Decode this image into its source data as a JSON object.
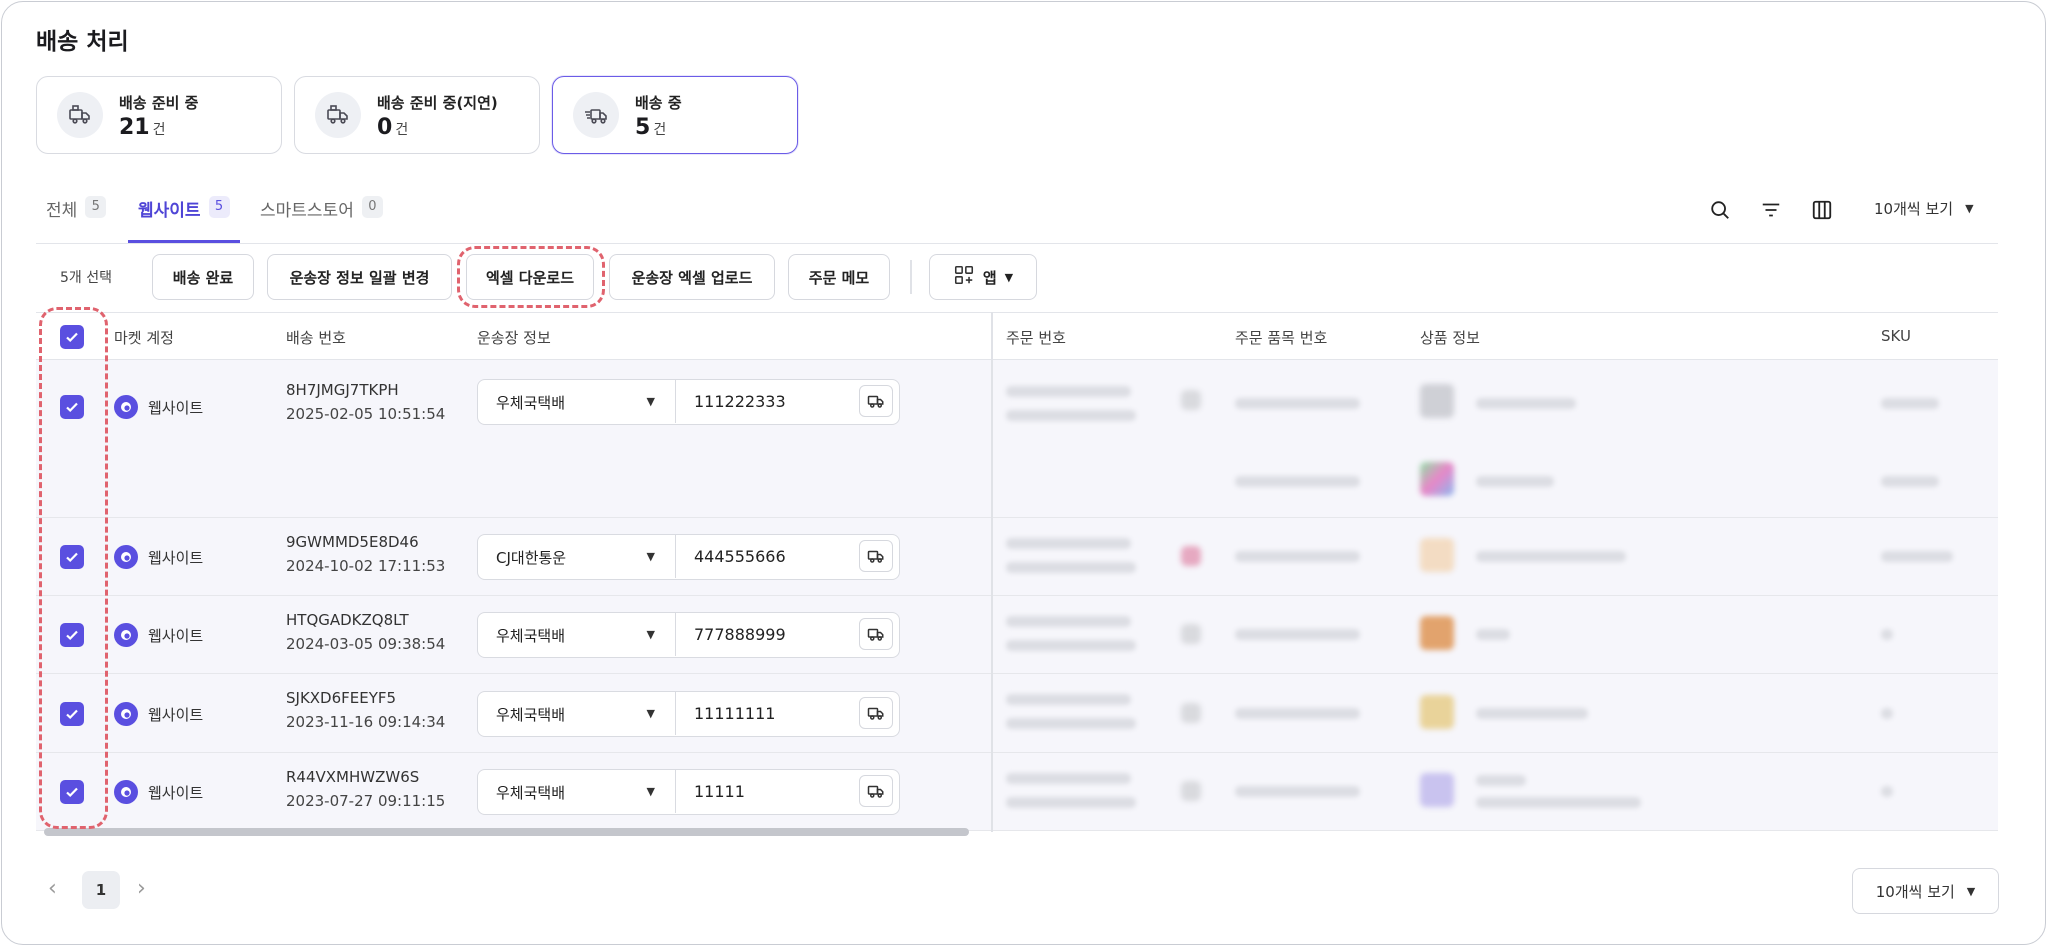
{
  "page": {
    "title": "배송 처리"
  },
  "cards": [
    {
      "label": "배송 준비 중",
      "count": "21",
      "unit": "건",
      "icon": "box-truck-icon",
      "active": false
    },
    {
      "label": "배송 준비 중(지연)",
      "count": "0",
      "unit": "건",
      "icon": "box-truck-icon",
      "active": false
    },
    {
      "label": "배송 중",
      "count": "5",
      "unit": "건",
      "icon": "moving-truck-icon",
      "active": true
    }
  ],
  "tabs": [
    {
      "label": "전체",
      "count": "5",
      "active": false
    },
    {
      "label": "웹사이트",
      "count": "5",
      "active": true
    },
    {
      "label": "스마트스토어",
      "count": "0",
      "active": false
    }
  ],
  "toolbar": {
    "icons": [
      "search-icon",
      "filter-icon",
      "columns-icon"
    ],
    "page_size": "10개씩 보기"
  },
  "actions": {
    "selected": "5개 선택",
    "buttons": [
      "배송 완료",
      "운송장 정보 일괄 변경",
      "엑셀 다운로드",
      "운송장 엑셀 업로드",
      "주문 메모"
    ],
    "apps_label": "앱"
  },
  "table": {
    "headers": [
      "마켓 계정",
      "배송 번호",
      "운송장 정보",
      "주문 번호",
      "주문 품목 번호",
      "상품 정보",
      "SKU"
    ],
    "rows": [
      {
        "market": "웹사이트",
        "ship_no": "8H7JMGJ7TKPH",
        "ship_date": "2025-02-05 10:51:54",
        "carrier": "우체국택배",
        "tracking": "111222333"
      },
      {
        "market": "웹사이트",
        "ship_no": "9GWMMD5E8D46",
        "ship_date": "2024-10-02 17:11:53",
        "carrier": "CJ대한통운",
        "tracking": "444555666"
      },
      {
        "market": "웹사이트",
        "ship_no": "HTQGADKZQ8LT",
        "ship_date": "2024-03-05 09:38:54",
        "carrier": "우체국택배",
        "tracking": "777888999"
      },
      {
        "market": "웹사이트",
        "ship_no": "SJKXD6FEEYF5",
        "ship_date": "2023-11-16 09:14:34",
        "carrier": "우체국택배",
        "tracking": "11111111"
      },
      {
        "market": "웹사이트",
        "ship_no": "R44VXMHWZW6S",
        "ship_date": "2023-07-27 09:11:15",
        "carrier": "우체국택배",
        "tracking": "11111"
      }
    ]
  },
  "pagination": {
    "current": "1",
    "page_size": "10개씩 보기"
  },
  "colors": {
    "accent": "#5a4fe0",
    "highlight": "#e0636e",
    "row_bg": "#f6f6fb"
  }
}
